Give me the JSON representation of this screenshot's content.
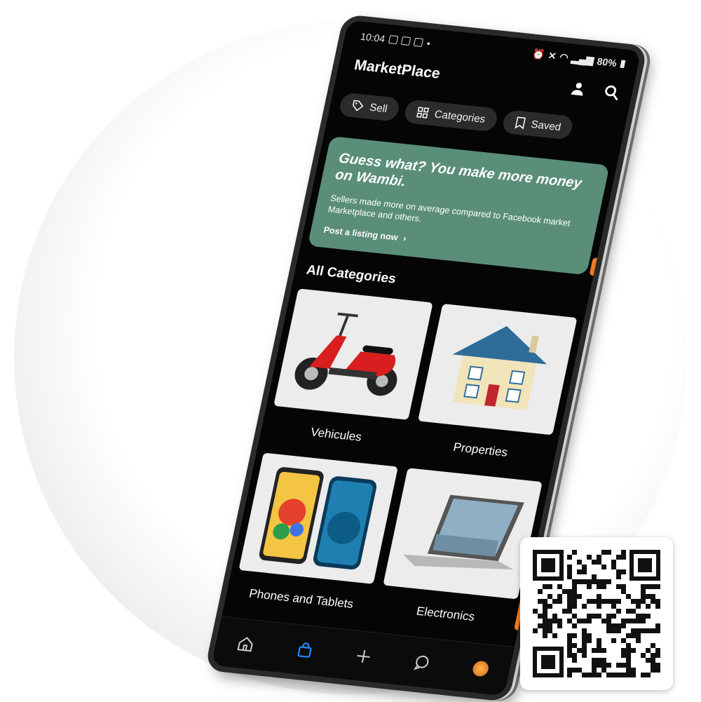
{
  "status_bar": {
    "time": "10:04",
    "dot": "•",
    "battery": "80%"
  },
  "header": {
    "title": "MarketPlace",
    "profile_icon": "person-icon",
    "search_icon": "search-icon"
  },
  "chips": [
    {
      "label": "Sell",
      "icon": "tag-icon"
    },
    {
      "label": "Categories",
      "icon": "grid-icon"
    },
    {
      "label": "Saved",
      "icon": "bookmark-icon"
    }
  ],
  "promo": {
    "title": "Guess what? You make more money on Wambi.",
    "text": "Sellers made more on average compared to Facebook market Marketplace and others.",
    "link": "Post a listing now",
    "link_arrow": "›",
    "color": "#5a8e78"
  },
  "categories": {
    "title": "All Categories",
    "items": [
      {
        "label": "Vehicules",
        "image": "scooter"
      },
      {
        "label": "Properties",
        "image": "house"
      },
      {
        "label": "Phones and Tablets",
        "image": "phones"
      },
      {
        "label": "Electronics",
        "image": "laptop"
      }
    ]
  },
  "bottom_nav": [
    {
      "icon": "home-icon",
      "active": false
    },
    {
      "icon": "shopping-bag-icon",
      "active": true
    },
    {
      "icon": "plus-icon",
      "active": false
    },
    {
      "icon": "chat-icon",
      "active": false
    },
    {
      "icon": "avatar",
      "active": false
    }
  ],
  "colors": {
    "accent": "#1e88ff",
    "side_buttons": "#f47a1f",
    "chip_bg": "#2b2b2b"
  }
}
